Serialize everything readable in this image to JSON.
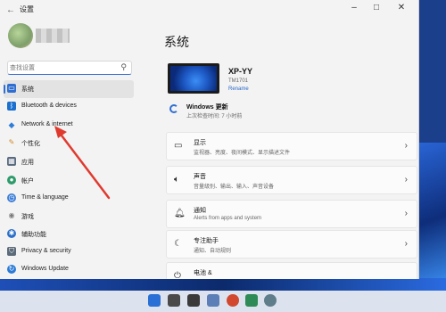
{
  "window": {
    "title": "设置"
  },
  "search": {
    "placeholder": "查找设置"
  },
  "sidebar": {
    "items": [
      {
        "label": "系统",
        "color": "#2f6ed1",
        "icon": "monitor-icon"
      },
      {
        "label": "Bluetooth & devices",
        "color": "#1a6fcf",
        "icon": "bluetooth-icon"
      },
      {
        "label": "Network & internet",
        "color": "#2f7fd8",
        "icon": "wifi-icon"
      },
      {
        "label": "个性化",
        "color": "#d08a2a",
        "icon": "brush-icon"
      },
      {
        "label": "应用",
        "color": "#5a6b80",
        "icon": "apps-icon"
      },
      {
        "label": "帐户",
        "color": "#2e9b6b",
        "icon": "person-icon"
      },
      {
        "label": "Time & language",
        "color": "#3f7fd6",
        "icon": "globe-clock-icon"
      },
      {
        "label": "游戏",
        "color": "#7a7a7a",
        "icon": "gamepad-icon"
      },
      {
        "label": "辅助功能",
        "color": "#2a6fc9",
        "icon": "accessibility-icon"
      },
      {
        "label": "Privacy & security",
        "color": "#5c6b7a",
        "icon": "shield-icon"
      },
      {
        "label": "Windows Update",
        "color": "#2a7ad6",
        "icon": "update-icon"
      }
    ]
  },
  "main": {
    "title": "系统",
    "device": {
      "name": "XP-YY",
      "model": "TM1701",
      "rename": "Rename"
    },
    "update": {
      "title": "Windows 更新",
      "subtitle": "上次检查时间: 7 小时前"
    },
    "cards": [
      {
        "title": "显示",
        "subtitle": "监视器、亮度、夜间模式、显示描述文件",
        "icon": "display-icon"
      },
      {
        "title": "声音",
        "subtitle": "音量级别、输出、输入、声音设备",
        "icon": "speaker-icon"
      },
      {
        "title": "通知",
        "subtitle": "Alerts from apps and system",
        "icon": "bell-icon"
      },
      {
        "title": "专注助手",
        "subtitle": "通知、自动规则",
        "icon": "moon-icon"
      },
      {
        "title": "电池 &",
        "subtitle": "",
        "icon": "power-icon"
      }
    ]
  }
}
